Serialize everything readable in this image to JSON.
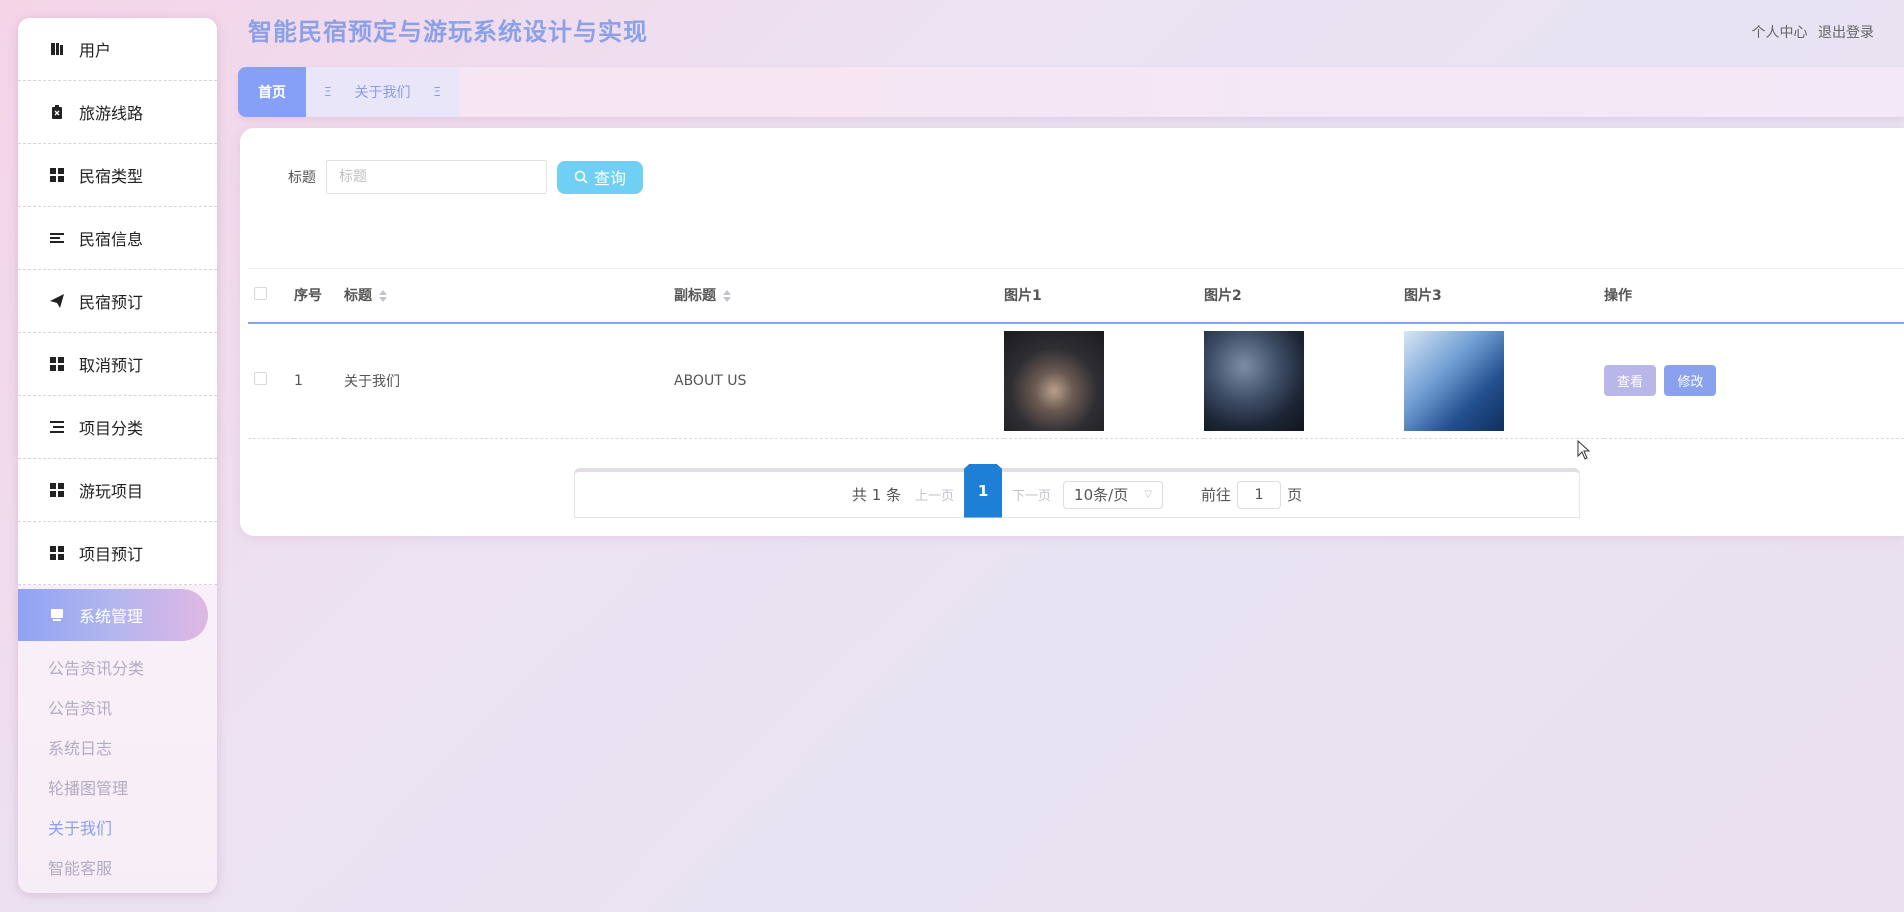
{
  "app": {
    "title": "智能民宿预定与游玩系统设计与实现",
    "personal_center": "个人中心",
    "logout": "退出登录"
  },
  "sidebar": {
    "items": [
      {
        "label": "用户",
        "icon": "book-icon"
      },
      {
        "label": "旅游线路",
        "icon": "clipboard-x-icon"
      },
      {
        "label": "民宿类型",
        "icon": "grid-icon"
      },
      {
        "label": "民宿信息",
        "icon": "list-icon"
      },
      {
        "label": "民宿预订",
        "icon": "paper-plane-icon"
      },
      {
        "label": "取消预订",
        "icon": "grid-icon"
      },
      {
        "label": "项目分类",
        "icon": "list-indent-icon"
      },
      {
        "label": "游玩项目",
        "icon": "grid-icon"
      },
      {
        "label": "项目预订",
        "icon": "grid-icon"
      },
      {
        "label": "系统管理",
        "icon": "monitor-icon"
      }
    ],
    "submenu": [
      "公告资讯分类",
      "公告资讯",
      "系统日志",
      "轮播图管理",
      "关于我们",
      "智能客服"
    ]
  },
  "tabs": {
    "home": "首页",
    "about": "关于我们"
  },
  "search": {
    "label": "标题",
    "placeholder": "标题",
    "value": "",
    "button": "查询"
  },
  "table": {
    "headers": {
      "index": "序号",
      "title": "标题",
      "subtitle": "副标题",
      "pic1": "图片1",
      "pic2": "图片2",
      "pic3": "图片3",
      "actions": "操作"
    },
    "rows": [
      {
        "index": "1",
        "title": "关于我们",
        "subtitle": "ABOUT US",
        "view": "查看",
        "edit": "修改"
      }
    ]
  },
  "pagination": {
    "total": "共 1 条",
    "prev": "上一页",
    "page": "1",
    "next": "下一页",
    "page_size": "10条/页",
    "goto_prefix": "前往",
    "goto_value": "1",
    "goto_suffix": "页"
  },
  "colors": {
    "accent": "#85a0f6",
    "title": "#8aa1e8",
    "search_button": "#6fd0f3",
    "page_active": "#1e7fd6"
  }
}
